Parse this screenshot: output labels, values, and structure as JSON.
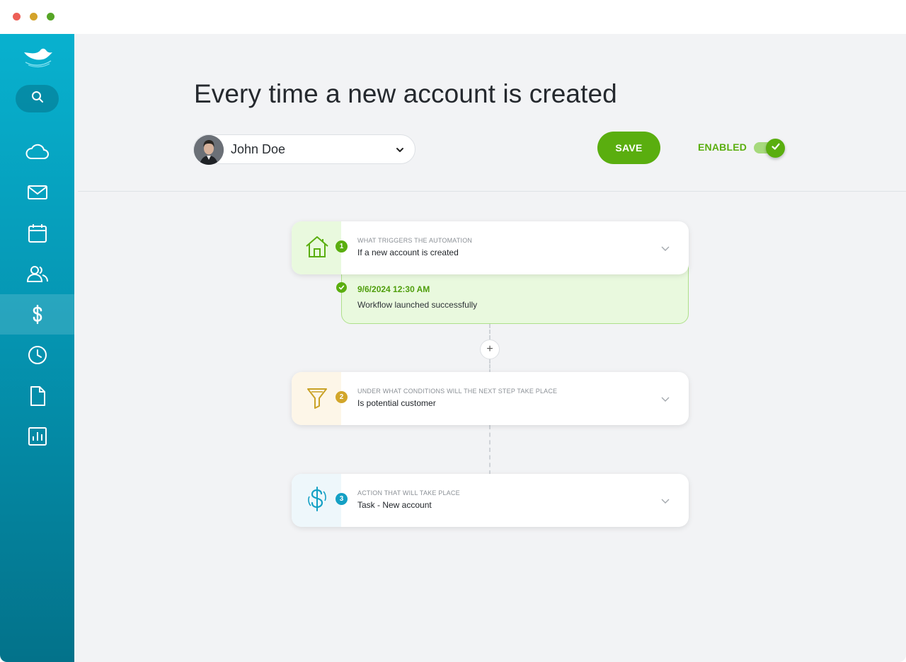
{
  "window": {
    "controls": [
      "close",
      "minimize",
      "zoom"
    ],
    "control_colors": [
      "#ed5f57",
      "#d4a32a",
      "#56a526"
    ]
  },
  "sidebar": {
    "logo_icon": "bird-logo-icon",
    "search_icon": "search-icon",
    "items": [
      {
        "id": "cloud",
        "icon": "cloud-icon",
        "active": false
      },
      {
        "id": "mail",
        "icon": "mail-icon",
        "active": false
      },
      {
        "id": "calendar",
        "icon": "calendar-icon",
        "active": false
      },
      {
        "id": "contacts",
        "icon": "users-icon",
        "active": false
      },
      {
        "id": "sales",
        "icon": "dollar-icon",
        "active": true
      },
      {
        "id": "history",
        "icon": "clock-icon",
        "active": false
      },
      {
        "id": "documents",
        "icon": "document-icon",
        "active": false
      },
      {
        "id": "reports",
        "icon": "bar-chart-icon",
        "active": false
      }
    ]
  },
  "header": {
    "title": "Every time a new account is created",
    "user": {
      "name": "John Doe"
    },
    "save_label": "SAVE",
    "enabled_label": "ENABLED",
    "enabled": true
  },
  "workflow": {
    "steps": [
      {
        "number": "1",
        "label": "WHAT TRIGGERS THE AUTOMATION",
        "title": "If a new account is created",
        "icon": "home-icon",
        "accent": "#5aae0f",
        "tint": "#e9f9de"
      },
      {
        "number": "2",
        "label": "UNDER WHAT CONDITIONS WILL THE NEXT STEP TAKE PLACE",
        "title": "Is potential customer",
        "icon": "filter-icon",
        "accent": "#c9a227",
        "tint": "#fdf6e8"
      },
      {
        "number": "3",
        "label": "ACTION THAT WILL TAKE PLACE",
        "title": "Task - New account",
        "icon": "dollar-icon",
        "accent": "#14a0c4",
        "tint": "#eef7fb"
      }
    ],
    "result": {
      "timestamp": "9/6/2024 12:30 AM",
      "message": "Workflow launched successfully"
    },
    "add_step_symbol": "+"
  }
}
